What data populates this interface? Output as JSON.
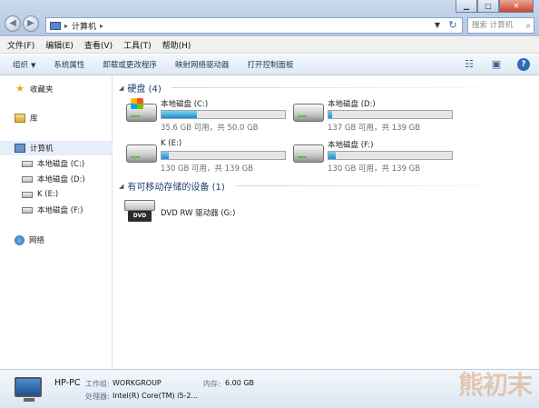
{
  "address": {
    "crumb": "计算机"
  },
  "search": {
    "placeholder": "搜索 计算机"
  },
  "menu": [
    "文件(F)",
    "编辑(E)",
    "查看(V)",
    "工具(T)",
    "帮助(H)"
  ],
  "toolbar": {
    "organize": "组织",
    "system_properties": "系统属性",
    "uninstall": "卸载或更改程序",
    "map_drive": "映射网络驱动器",
    "control_panel": "打开控制面板"
  },
  "sidebar": {
    "favorites": "收藏夹",
    "libraries": "库",
    "computer": "计算机",
    "drives": [
      "本地磁盘 (C:)",
      "本地磁盘 (D:)",
      "K (E:)",
      "本地磁盘 (F:)"
    ],
    "network": "网络"
  },
  "groups": {
    "hard_disks": "硬盘 (4)",
    "removable": "有可移动存储的设备 (1)"
  },
  "drives": [
    {
      "name": "本地磁盘 (C:)",
      "free_text": "35.6 GB 可用，共 50.0 GB",
      "used_fraction": 0.29,
      "system": true
    },
    {
      "name": "本地磁盘 (D:)",
      "free_text": "137 GB 可用，共 139 GB",
      "used_fraction": 0.01,
      "system": false
    },
    {
      "name": "K (E:)",
      "free_text": "130 GB 可用，共 139 GB",
      "used_fraction": 0.06,
      "system": false
    },
    {
      "name": "本地磁盘 (F:)",
      "free_text": "130 GB 可用，共 139 GB",
      "used_fraction": 0.06,
      "system": false
    }
  ],
  "dvd": {
    "name": "DVD RW 驱动器 (G:)",
    "icon_text": "DVD"
  },
  "details": {
    "pc_name": "HP-PC",
    "workgroup_label": "工作组:",
    "workgroup_value": "WORKGROUP",
    "memory_label": "内存:",
    "memory_value": "6.00 GB",
    "cpu_label": "处理器:",
    "cpu_value": "Intel(R) Core(TM) i5-2..."
  },
  "watermark": "熊初末"
}
